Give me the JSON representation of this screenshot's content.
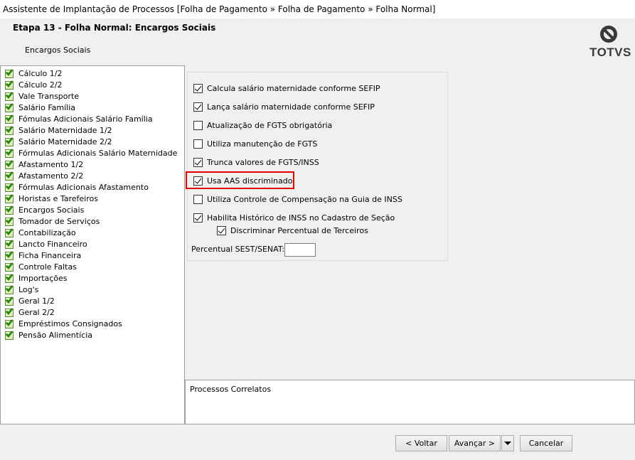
{
  "window": {
    "title": "Assistente de Implantação de Processos [Folha de Pagamento » Folha de Pagamento » Folha Normal]"
  },
  "header": {
    "step_title": "Etapa 13 - Folha Normal: Encargos Sociais",
    "subtitle": "Encargos Sociais",
    "logo_text": "TOTVS"
  },
  "tree": {
    "items": [
      {
        "label": "Cálculo 1/2",
        "icon": "green-check-icon"
      },
      {
        "label": "Cálculo 2/2",
        "icon": "green-check-icon"
      },
      {
        "label": "Vale Transporte",
        "icon": "green-check-icon"
      },
      {
        "label": "Salário Família",
        "icon": "green-check-icon"
      },
      {
        "label": "Fómulas Adicionais Salário Família",
        "icon": "green-check-icon"
      },
      {
        "label": "Salário Maternidade 1/2",
        "icon": "green-check-icon"
      },
      {
        "label": "Salário Maternidade 2/2",
        "icon": "green-check-icon"
      },
      {
        "label": "Fórmulas Adicionais Salário Maternidade",
        "icon": "green-check-icon"
      },
      {
        "label": "Afastamento 1/2",
        "icon": "green-check-icon"
      },
      {
        "label": "Afastamento 2/2",
        "icon": "green-check-icon"
      },
      {
        "label": "Fórmulas Adicionais Afastamento",
        "icon": "green-check-icon"
      },
      {
        "label": "Horistas e Tarefeiros",
        "icon": "green-check-icon"
      },
      {
        "label": "Encargos Sociais",
        "icon": "green-check-icon"
      },
      {
        "label": "Tomador de Serviços",
        "icon": "green-check-icon"
      },
      {
        "label": "Contabilização",
        "icon": "green-check-icon"
      },
      {
        "label": "Lancto Financeiro",
        "icon": "green-check-icon"
      },
      {
        "label": "Ficha Financeira",
        "icon": "green-check-icon"
      },
      {
        "label": "Controle Faltas",
        "icon": "green-check-icon"
      },
      {
        "label": "Importações",
        "icon": "green-check-icon"
      },
      {
        "label": "Log's",
        "icon": "green-check-icon"
      },
      {
        "label": "Geral 1/2",
        "icon": "green-check-icon"
      },
      {
        "label": "Geral 2/2",
        "icon": "green-check-icon"
      },
      {
        "label": "Empréstimos Consignados",
        "icon": "green-check-icon"
      },
      {
        "label": "Pensão Alimentícia",
        "icon": "green-check-icon"
      }
    ]
  },
  "options": [
    {
      "label": "Calcula salário maternidade conforme SEFIP",
      "checked": true
    },
    {
      "label": "Lança salário maternidade conforme SEFIP",
      "checked": true
    },
    {
      "label": "Atualização de FGTS obrigatória",
      "checked": false
    },
    {
      "label": "Utiliza manutenção de FGTS",
      "checked": false
    },
    {
      "label": "Trunca valores de FGTS/INSS",
      "checked": true
    },
    {
      "label": "Usa AAS discriminado",
      "checked": true
    },
    {
      "label": "Utiliza Controle de Compensação na Guia de INSS",
      "checked": false
    },
    {
      "label": "Habilita Histórico de INSS no Cadastro de Seção",
      "checked": true
    },
    {
      "label": "Discriminar Percentual de Terceiros",
      "checked": true
    }
  ],
  "sest": {
    "label": "Percentual SEST/SENAT:",
    "value": ""
  },
  "correlatos": {
    "label": "Processos Correlatos"
  },
  "buttons": {
    "back": "< Voltar",
    "next": "Avançar >",
    "cancel": "Cancelar"
  },
  "colors": {
    "highlight": "#e00000",
    "check_green": "#2e8a12"
  }
}
